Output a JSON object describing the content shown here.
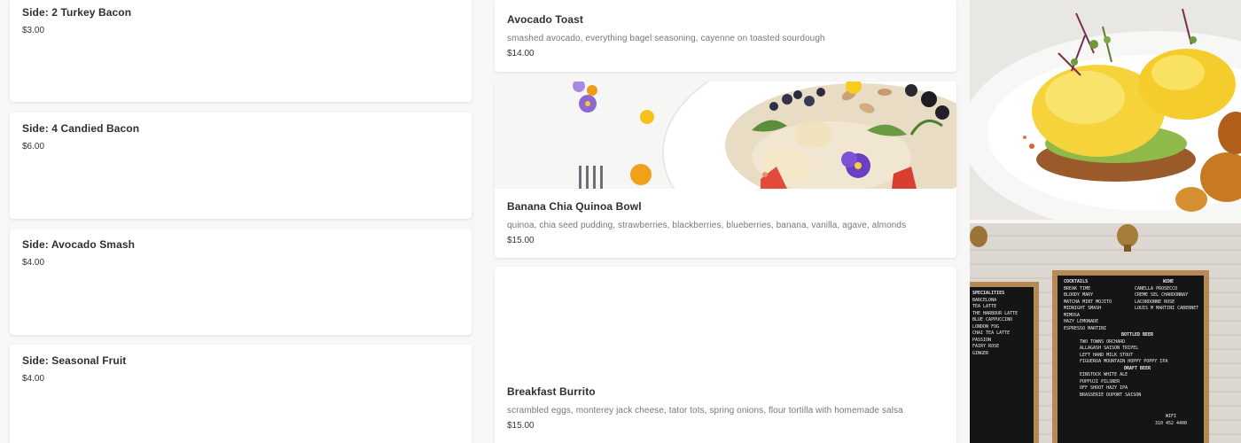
{
  "menu": {
    "sides": [
      {
        "name": "Side: 2 Turkey Bacon",
        "price": "$3.00"
      },
      {
        "name": "Side: 4 Candied Bacon",
        "price": "$6.00"
      },
      {
        "name": "Side: Avocado Smash",
        "price": "$4.00"
      },
      {
        "name": "Side: Seasonal Fruit",
        "price": "$4.00"
      }
    ],
    "items": [
      {
        "name": "Avocado Toast",
        "description": "smashed avocado, everything bagel seasoning, cayenne on toasted sourdough",
        "price": "$14.00"
      },
      {
        "name": "Banana Chia Quinoa Bowl",
        "description": "quinoa, chia seed pudding, strawberries, blackberries, blueberries, banana, vanilla, agave, almonds",
        "price": "$15.00"
      },
      {
        "name": "Breakfast Burrito",
        "description": "scrambled eggs, monterey jack cheese, tator tots, spring onions, flour tortilla with homemade salsa",
        "price": "$15.00"
      }
    ]
  },
  "board": {
    "left_header": "SPECIALITIES",
    "left_lines": [
      "BARCELONA",
      "TEA LATTE",
      "THE HARBOUR LATTE",
      "BLUE CAPPUCCINO",
      "LONDON FOG",
      "CHAI TEA LATTE",
      "PASSION",
      "FAIRY ROSE",
      "GINGER"
    ],
    "cocktails_header": "COCKTAILS",
    "cocktails": [
      "BREAK TIME",
      "BLOODY MARY",
      "MATCHA MINT MOJITO",
      "MIDNIGHT SMASH",
      "MIMOSA",
      "HAZY LEMONADE",
      "ESPRESSO MARTINI"
    ],
    "wine_header": "WINE",
    "wine": [
      "CANELLA PROSECCO",
      "CREME SEL CHARDONNAY",
      "LACORDONNE ROSE",
      "LOUIS M MARTINI CABERNET"
    ],
    "bottled_header": "BOTTLED BEER",
    "bottled": [
      "TWO TOWNS ORCHARD",
      "ALLAGASH SAISON TRIPEL",
      "LEFT HAND MILK STOUT",
      "FIGUEROA MOUNTAIN HOPPY POPPY IPA"
    ],
    "draft_header": "DRAFT BEER",
    "draft": [
      "EINSTOCK WHITE ALE",
      "POPFUJI PILSNER",
      "OFF SHOOT HAZY IPA",
      "BRASSERIE DUPONT SAISON"
    ],
    "wifi_label": "WIFI",
    "wifi_number": "310 452 4400"
  },
  "colors": {
    "card": "#ffffff",
    "background": "#f7f7f7",
    "board": "#151515",
    "frame": "#b58a55"
  }
}
